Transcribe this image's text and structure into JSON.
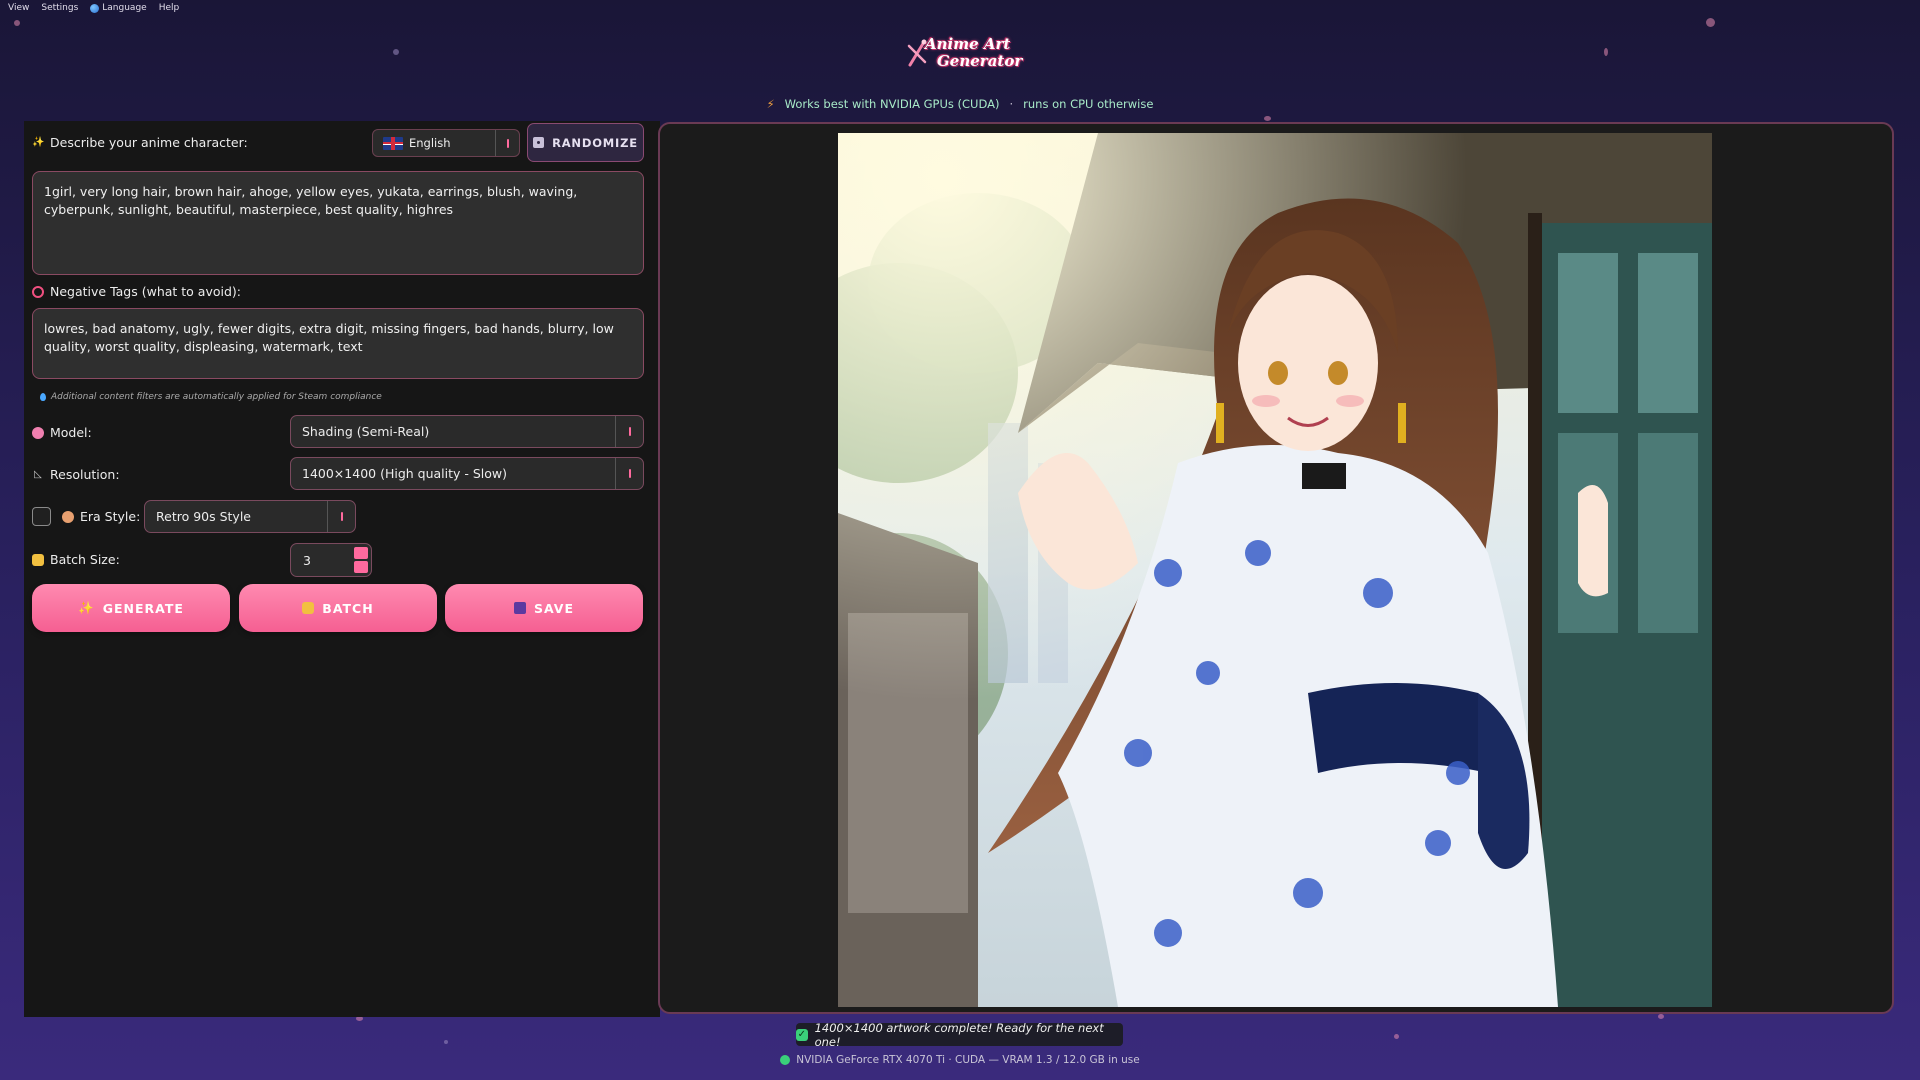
{
  "menu": [
    "View",
    "Settings",
    "Language",
    "Help"
  ],
  "logo": {
    "line1": "Anime Art",
    "line2": "Generator"
  },
  "gpu_note": {
    "left": "Works best with NVIDIA GPUs (CUDA)",
    "sep": "·",
    "right": "runs on CPU otherwise"
  },
  "prompt": {
    "label": "Describe your anime character:",
    "language": "English",
    "randomize_label": "RANDOMIZE",
    "value": "1girl, very long hair, brown hair, ahoge, yellow eyes, yukata, earrings, blush, waving, cyberpunk, sunlight, beautiful, masterpiece, best quality, highres"
  },
  "negative": {
    "label": "Negative Tags (what to avoid):",
    "value": "lowres, bad anatomy, ugly, fewer digits, extra digit, missing fingers, bad hands, blurry, low quality, worst quality, displeasing, watermark, text"
  },
  "hint": "Additional content filters are automatically applied for Steam compliance",
  "model": {
    "label": "Model:",
    "value": "Shading (Semi-Real)"
  },
  "resolution": {
    "label": "Resolution:",
    "value": "1400×1400 (High quality - Slow)"
  },
  "era": {
    "label": "Era Style:",
    "value": "Retro 90s Style",
    "enabled": false
  },
  "batch": {
    "label": "Batch Size:",
    "value": "3"
  },
  "buttons": {
    "generate": "GENERATE",
    "batch": "BATCH",
    "save": "SAVE"
  },
  "status": "1400×1400 artwork complete! Ready for the next one!",
  "gpu_status": "NVIDIA GeForce RTX 4070 Ti · CUDA — VRAM 1.3 / 12.0 GB in use",
  "colors": {
    "accent": "#f55f92",
    "panel": "#161616",
    "border": "#8a4a62"
  }
}
